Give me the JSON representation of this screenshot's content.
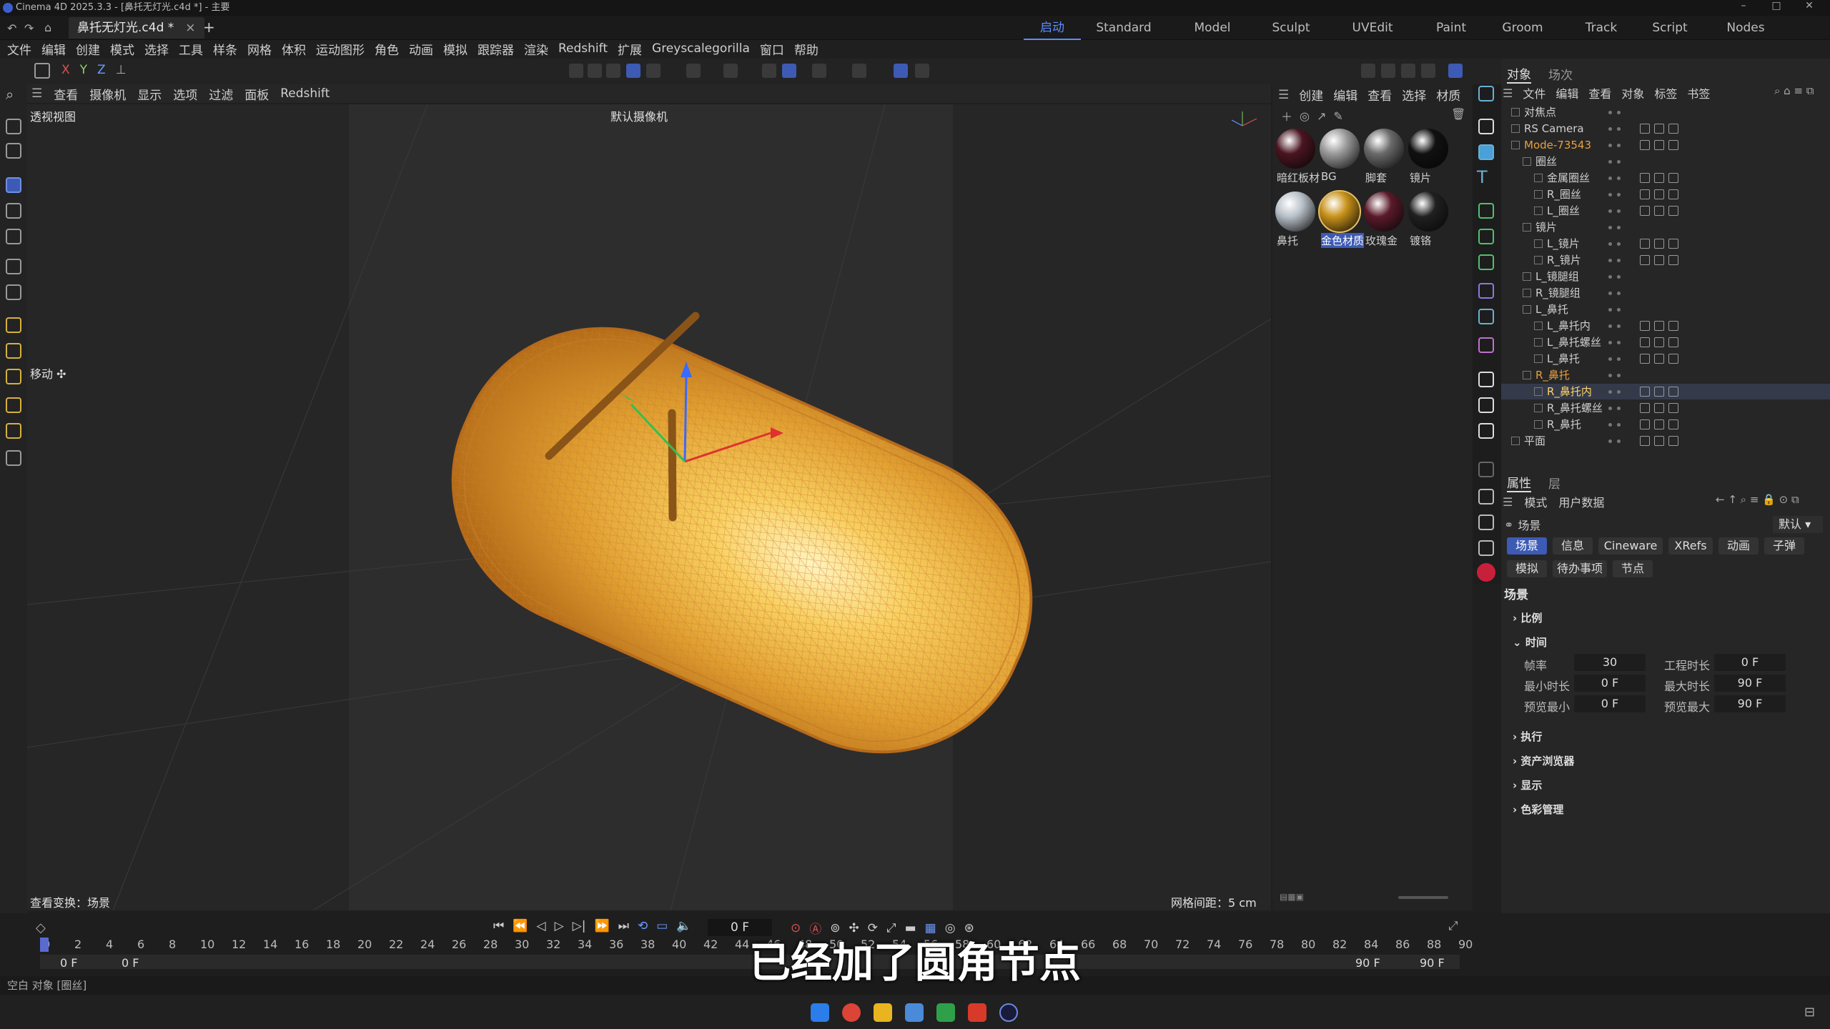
{
  "window": {
    "title": "Cinema 4D 2025.3.3 - [鼻托无灯光.c4d *] - 主要",
    "min": "–",
    "max": "□",
    "close": "✕"
  },
  "file_tab": {
    "label": "鼻托无灯光.c4d *",
    "close": "×",
    "add": "+"
  },
  "layouts": [
    "启动",
    "Standard",
    "Model",
    "Sculpt",
    "UVEdit",
    "Paint",
    "Groom",
    "Track",
    "Script",
    "Nodes"
  ],
  "menubar": [
    "文件",
    "编辑",
    "创建",
    "模式",
    "选择",
    "工具",
    "样条",
    "网格",
    "体积",
    "运动图形",
    "角色",
    "动画",
    "模拟",
    "跟踪器",
    "渲染",
    "Redshift",
    "扩展",
    "Greyscalegorilla",
    "窗口",
    "帮助"
  ],
  "axis_toggles": [
    "X",
    "Y",
    "Z"
  ],
  "viewport": {
    "menu": [
      "查看",
      "摄像机",
      "显示",
      "选项",
      "过滤",
      "面板",
      "Redshift"
    ],
    "view_name": "透视视图",
    "camera": "默认摄像机",
    "tool_label": "移动 ✣",
    "status_left": "查看变换：场景",
    "grid_spacing": "网格间距：5 cm"
  },
  "material_menu": [
    "创建",
    "编辑",
    "查看",
    "选择",
    "材质"
  ],
  "materials": [
    {
      "name": "暗红板材",
      "color": "#4a1520"
    },
    {
      "name": "BG",
      "color": "#9a9a9a"
    },
    {
      "name": "脚套",
      "color": "#6a6a6a"
    },
    {
      "name": "镜片",
      "color": "#111111"
    },
    {
      "name": "鼻托",
      "color": "#b8c0c8"
    },
    {
      "name": "金色材质",
      "color": "#c8921a"
    },
    {
      "name": "玫瑰金",
      "color": "#5a1a2a"
    },
    {
      "name": "镀铬",
      "color": "#202020"
    }
  ],
  "object_panel": {
    "tabs": [
      "对象",
      "场次"
    ],
    "menu": [
      "文件",
      "编辑",
      "查看",
      "对象",
      "标签",
      "书签"
    ],
    "rows": [
      {
        "name": "对焦点",
        "level": 0
      },
      {
        "name": "RS Camera",
        "level": 0
      },
      {
        "name": "Mode-73543",
        "level": 0,
        "color": "#e8a040"
      },
      {
        "name": "圈丝",
        "level": 1
      },
      {
        "name": "金属圈丝",
        "level": 2
      },
      {
        "name": "R_圈丝",
        "level": 2
      },
      {
        "name": "L_圈丝",
        "level": 2
      },
      {
        "name": "镜片",
        "level": 1
      },
      {
        "name": "L_镜片",
        "level": 2
      },
      {
        "name": "R_镜片",
        "level": 2
      },
      {
        "name": "L_镜腿组",
        "level": 1
      },
      {
        "name": "R_镜腿组",
        "level": 1
      },
      {
        "name": "L_鼻托",
        "level": 1
      },
      {
        "name": "L_鼻托内",
        "level": 2
      },
      {
        "name": "L_鼻托螺丝",
        "level": 2
      },
      {
        "name": "L_鼻托",
        "level": 2
      },
      {
        "name": "R_鼻托",
        "level": 1,
        "color": "#e8a040"
      },
      {
        "name": "R_鼻托内",
        "level": 2,
        "color": "#ffd36a"
      },
      {
        "name": "R_鼻托螺丝",
        "level": 2
      },
      {
        "name": "R_鼻托",
        "level": 2
      },
      {
        "name": "平面",
        "level": 0
      }
    ]
  },
  "attributes": {
    "tabs": [
      "属性",
      "层"
    ],
    "menu": [
      "模式",
      "用户数据"
    ],
    "scene_label": "场景",
    "preset": "默认",
    "buttons_row1": [
      "场景",
      "信息",
      "Cineware",
      "XRefs",
      "动画",
      "子弹"
    ],
    "buttons_row2": [
      "模拟",
      "待办事项",
      "节点"
    ],
    "heading": "场景",
    "sections_top": [
      "比例",
      "时间"
    ],
    "time": {
      "fps_label": "帧率",
      "fps": "30",
      "project_len_label": "工程时长",
      "project_len": "0 F",
      "min_len_label": "最小时长",
      "min_len": "0 F",
      "max_len_label": "最大时长",
      "max_len": "90 F",
      "preview_min_label": "预览最小",
      "preview_min": "0 F",
      "preview_max_label": "预览最大",
      "preview_max": "90 F"
    },
    "sections_bottom": [
      "执行",
      "资产浏览器",
      "显示",
      "色彩管理"
    ]
  },
  "timeline": {
    "current_frame": "0 F",
    "ticks": [
      "0",
      "2",
      "4",
      "6",
      "8",
      "10",
      "12",
      "14",
      "16",
      "18",
      "20",
      "22",
      "24",
      "26",
      "28",
      "30",
      "32",
      "34",
      "36",
      "38",
      "40",
      "42",
      "44",
      "46",
      "48",
      "50",
      "52",
      "54",
      "56",
      "58",
      "60",
      "62",
      "64",
      "66",
      "68",
      "70",
      "72",
      "74",
      "76",
      "78",
      "80",
      "82",
      "84",
      "86",
      "88",
      "90"
    ],
    "start_a": "0 F",
    "start_b": "0 F",
    "end_a": "90 F",
    "end_b": "90 F"
  },
  "status_bar": "空白 对象 [圈丝]",
  "subtitle": "已经加了圆角节点"
}
